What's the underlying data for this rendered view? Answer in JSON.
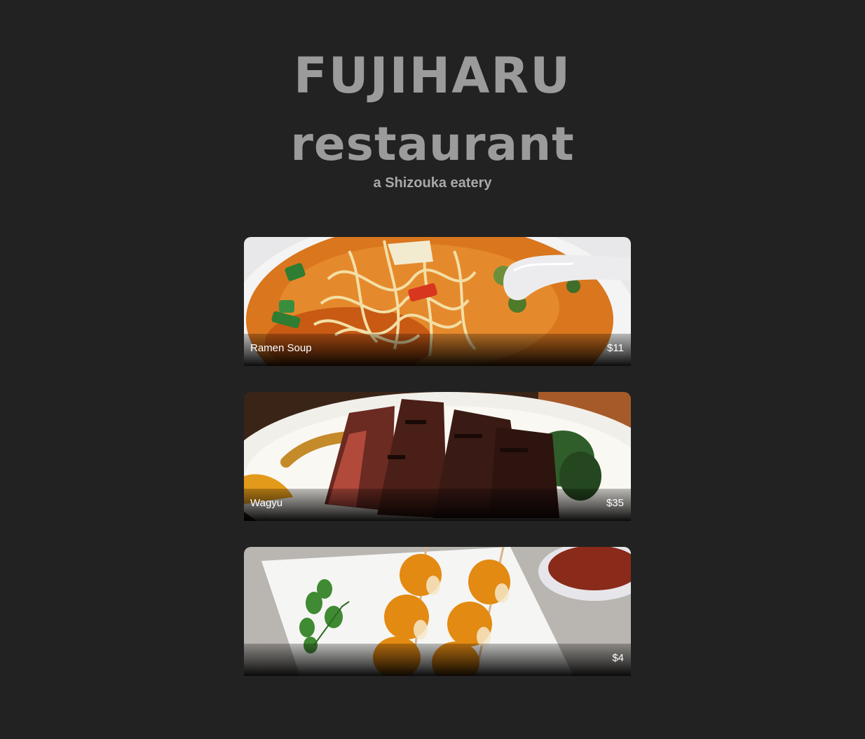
{
  "header": {
    "brand_line1": "FUJIHARU",
    "brand_line2": "restaurant",
    "tagline": "a Shizouka eatery"
  },
  "menu": {
    "items": [
      {
        "name": "Ramen Soup",
        "price": "$11"
      },
      {
        "name": "Wagyu",
        "price": "$35"
      },
      {
        "name": "",
        "price": "$4"
      }
    ]
  },
  "colors": {
    "background": "#222222",
    "brand_text": "#9b9b9b",
    "caption_text": "#ffffff"
  }
}
